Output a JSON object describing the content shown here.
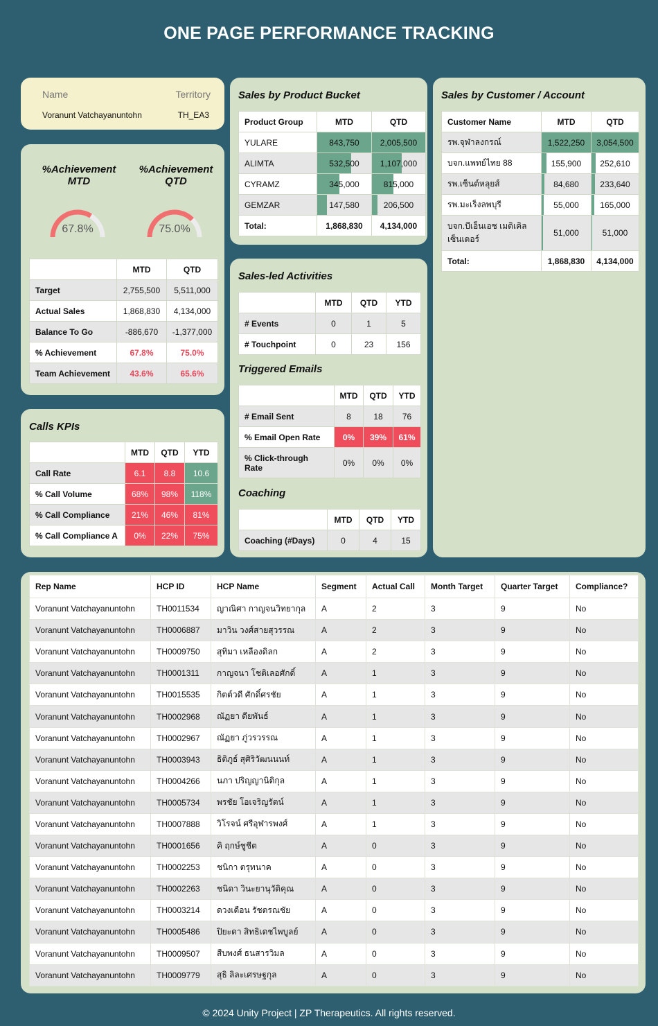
{
  "page_title": "ONE PAGE PERFORMANCE TRACKING",
  "profile": {
    "name_label": "Name",
    "territory_label": "Territory",
    "name": "Voranunt Vatchayanuntohn",
    "territory": "TH_EA3"
  },
  "achievement": {
    "mtd_title": "%Achievement MTD",
    "qtd_title": "%Achievement QTD",
    "mtd_value": "67.8%",
    "qtd_value": "75.0%",
    "mtd_fraction": 0.678,
    "qtd_fraction": 0.75,
    "headers": [
      "",
      "MTD",
      "QTD"
    ],
    "rows": [
      {
        "label": "Target",
        "mtd": "2,755,500",
        "qtd": "5,511,000"
      },
      {
        "label": "Actual Sales",
        "mtd": "1,868,830",
        "qtd": "4,134,000"
      },
      {
        "label": "Balance To Go",
        "mtd": "-886,670",
        "qtd": "-1,377,000"
      },
      {
        "label": "% Achievement",
        "mtd": "67.8%",
        "qtd": "75.0%"
      },
      {
        "label": "Team Achievement",
        "mtd": "43.6%",
        "qtd": "65.6%"
      }
    ]
  },
  "calls": {
    "title": "Calls KPIs",
    "headers": [
      "",
      "MTD",
      "QTD",
      "YTD"
    ],
    "rows": [
      {
        "label": "Call Rate",
        "mtd": "6.1",
        "qtd": "8.8",
        "ytd": "10.6"
      },
      {
        "label": "% Call Volume",
        "mtd": "68%",
        "qtd": "98%",
        "ytd": "118%"
      },
      {
        "label": "% Call Compliance",
        "mtd": "21%",
        "qtd": "46%",
        "ytd": "81%"
      },
      {
        "label": "% Call Compliance A",
        "mtd": "0%",
        "qtd": "22%",
        "ytd": "75%"
      }
    ]
  },
  "product": {
    "title": "Sales by Product Bucket",
    "headers": [
      "Product Group",
      "MTD",
      "QTD"
    ],
    "rows": [
      {
        "label": "YULARE",
        "mtd": "843,750",
        "qtd": "2,005,500",
        "mtd_frac": 1.0,
        "qtd_frac": 1.0
      },
      {
        "label": "ALIMTA",
        "mtd": "532,500",
        "qtd": "1,107,000",
        "mtd_frac": 0.631,
        "qtd_frac": 0.552
      },
      {
        "label": "CYRAMZ",
        "mtd": "345,000",
        "qtd": "815,000",
        "mtd_frac": 0.409,
        "qtd_frac": 0.406
      },
      {
        "label": "GEMZAR",
        "mtd": "147,580",
        "qtd": "206,500",
        "mtd_frac": 0.175,
        "qtd_frac": 0.103
      }
    ],
    "total_label": "Total:",
    "total_mtd": "1,868,830",
    "total_qtd": "4,134,000"
  },
  "activities": {
    "title": "Sales-led Activities",
    "headers": [
      "",
      "MTD",
      "QTD",
      "YTD"
    ],
    "rows": [
      {
        "label": "# Events",
        "mtd": "0",
        "qtd": "1",
        "ytd": "5"
      },
      {
        "label": "# Touchpoint",
        "mtd": "0",
        "qtd": "23",
        "ytd": "156"
      }
    ]
  },
  "emails": {
    "title": "Triggered Emails",
    "headers": [
      "",
      "MTD",
      "QTD",
      "YTD"
    ],
    "rows": [
      {
        "label": "# Email Sent",
        "mtd": "8",
        "qtd": "18",
        "ytd": "76"
      },
      {
        "label": "% Email Open Rate",
        "mtd": "0%",
        "qtd": "39%",
        "ytd": "61%"
      },
      {
        "label": "% Click-through Rate",
        "mtd": "0%",
        "qtd": "0%",
        "ytd": "0%"
      }
    ]
  },
  "coaching": {
    "title": "Coaching",
    "headers": [
      "",
      "MTD",
      "QTD",
      "YTD"
    ],
    "rows": [
      {
        "label": "Coaching (#Days)",
        "mtd": "0",
        "qtd": "4",
        "ytd": "15"
      }
    ]
  },
  "customer": {
    "title": "Sales by Customer / Account",
    "headers": [
      "Customer Name",
      "MTD",
      "QTD"
    ],
    "rows": [
      {
        "label": "รพ.จุฬาลงกรณ์",
        "mtd": "1,522,250",
        "qtd": "3,054,500",
        "mtd_frac": 1.0,
        "qtd_frac": 1.0
      },
      {
        "label": "บจก.แพทย์ไทย 88",
        "mtd": "155,900",
        "qtd": "252,610",
        "mtd_frac": 0.102,
        "qtd_frac": 0.083
      },
      {
        "label": "รพ.เซ็นต์หลุยส์",
        "mtd": "84,680",
        "qtd": "233,640",
        "mtd_frac": 0.056,
        "qtd_frac": 0.076
      },
      {
        "label": "รพ.มะเร็งลพบุรี",
        "mtd": "55,000",
        "qtd": "165,000",
        "mtd_frac": 0.036,
        "qtd_frac": 0.054
      },
      {
        "label": "บจก.บีเอ็นเอช เมดิเคิล เซ็นเตอร์",
        "mtd": "51,000",
        "qtd": "51,000",
        "mtd_frac": 0.034,
        "qtd_frac": 0.017
      }
    ],
    "total_label": "Total:",
    "total_mtd": "1,868,830",
    "total_qtd": "4,134,000"
  },
  "hcp": {
    "headers": [
      "Rep Name",
      "HCP ID",
      "HCP Name",
      "Segment",
      "Actual Call",
      "Month Target",
      "Quarter Target",
      "Compliance?"
    ],
    "rows": [
      [
        "Voranunt Vatchayanuntohn",
        "TH0011534",
        "ญาณิศา กาญจนวิทยากุล",
        "A",
        "2",
        "3",
        "9",
        "No"
      ],
      [
        "Voranunt Vatchayanuntohn",
        "TH0006887",
        "มาวิน วงศ์สายสุวรรณ",
        "A",
        "2",
        "3",
        "9",
        "No"
      ],
      [
        "Voranunt Vatchayanuntohn",
        "TH0009750",
        "สุทิมา เหลืองดิลก",
        "A",
        "2",
        "3",
        "9",
        "No"
      ],
      [
        "Voranunt Vatchayanuntohn",
        "TH0001311",
        "กาญจนา โชติเลอศักดิ์",
        "A",
        "1",
        "3",
        "9",
        "No"
      ],
      [
        "Voranunt Vatchayanuntohn",
        "TH0015535",
        "กิตต์วดี ศักดิ์ศรชัย",
        "A",
        "1",
        "3",
        "9",
        "No"
      ],
      [
        "Voranunt Vatchayanuntohn",
        "TH0002968",
        "ณัฏยา ดียพันธ์",
        "A",
        "1",
        "3",
        "9",
        "No"
      ],
      [
        "Voranunt Vatchayanuntohn",
        "TH0002967",
        "ณัฏยา ภู่วรวรรณ",
        "A",
        "1",
        "3",
        "9",
        "No"
      ],
      [
        "Voranunt Vatchayanuntohn",
        "TH0003943",
        "ธิติภูธ์ สุศิริวัฒนนนท์",
        "A",
        "1",
        "3",
        "9",
        "No"
      ],
      [
        "Voranunt Vatchayanuntohn",
        "TH0004266",
        "นภา ปริญญานิติกุล",
        "A",
        "1",
        "3",
        "9",
        "No"
      ],
      [
        "Voranunt Vatchayanuntohn",
        "TH0005734",
        "พรชัย โอเจริญรัตน์",
        "A",
        "1",
        "3",
        "9",
        "No"
      ],
      [
        "Voranunt Vatchayanuntohn",
        "TH0007888",
        "วิโรจน์ ศรีอุฬารพงศ์",
        "A",
        "1",
        "3",
        "9",
        "No"
      ],
      [
        "Voranunt Vatchayanuntohn",
        "TH0001656",
        "คิ ฤกษ์ชูชีต",
        "A",
        "0",
        "3",
        "9",
        "No"
      ],
      [
        "Voranunt Vatchayanuntohn",
        "TH0002253",
        "ชนิกา ตรุทนาค",
        "A",
        "0",
        "3",
        "9",
        "No"
      ],
      [
        "Voranunt Vatchayanuntohn",
        "TH0002263",
        "ชนิดา วินะยานุวัติคุณ",
        "A",
        "0",
        "3",
        "9",
        "No"
      ],
      [
        "Voranunt Vatchayanuntohn",
        "TH0003214",
        "ดวงเดือน รัชตรณชัย",
        "A",
        "0",
        "3",
        "9",
        "No"
      ],
      [
        "Voranunt Vatchayanuntohn",
        "TH0005486",
        "ปิยะดา สิทธิเดชไพบูลย์",
        "A",
        "0",
        "3",
        "9",
        "No"
      ],
      [
        "Voranunt Vatchayanuntohn",
        "TH0009507",
        "สืบพงศ์ ธนสารวิมล",
        "A",
        "0",
        "3",
        "9",
        "No"
      ],
      [
        "Voranunt Vatchayanuntohn",
        "TH0009779",
        "สุธิ ลิละเศรษฐกุล",
        "A",
        "0",
        "3",
        "9",
        "No"
      ]
    ]
  },
  "footer": "© 2024 Unity Project | ZP Therapeutics. All rights reserved.",
  "colors": {
    "background": "#2e5f70",
    "card": "#d4e0c8",
    "profile_card": "#f5f1cc",
    "bar_green": "#6aa58c",
    "alert_red": "#ef4c5c",
    "gauge_red": "#f07070"
  }
}
